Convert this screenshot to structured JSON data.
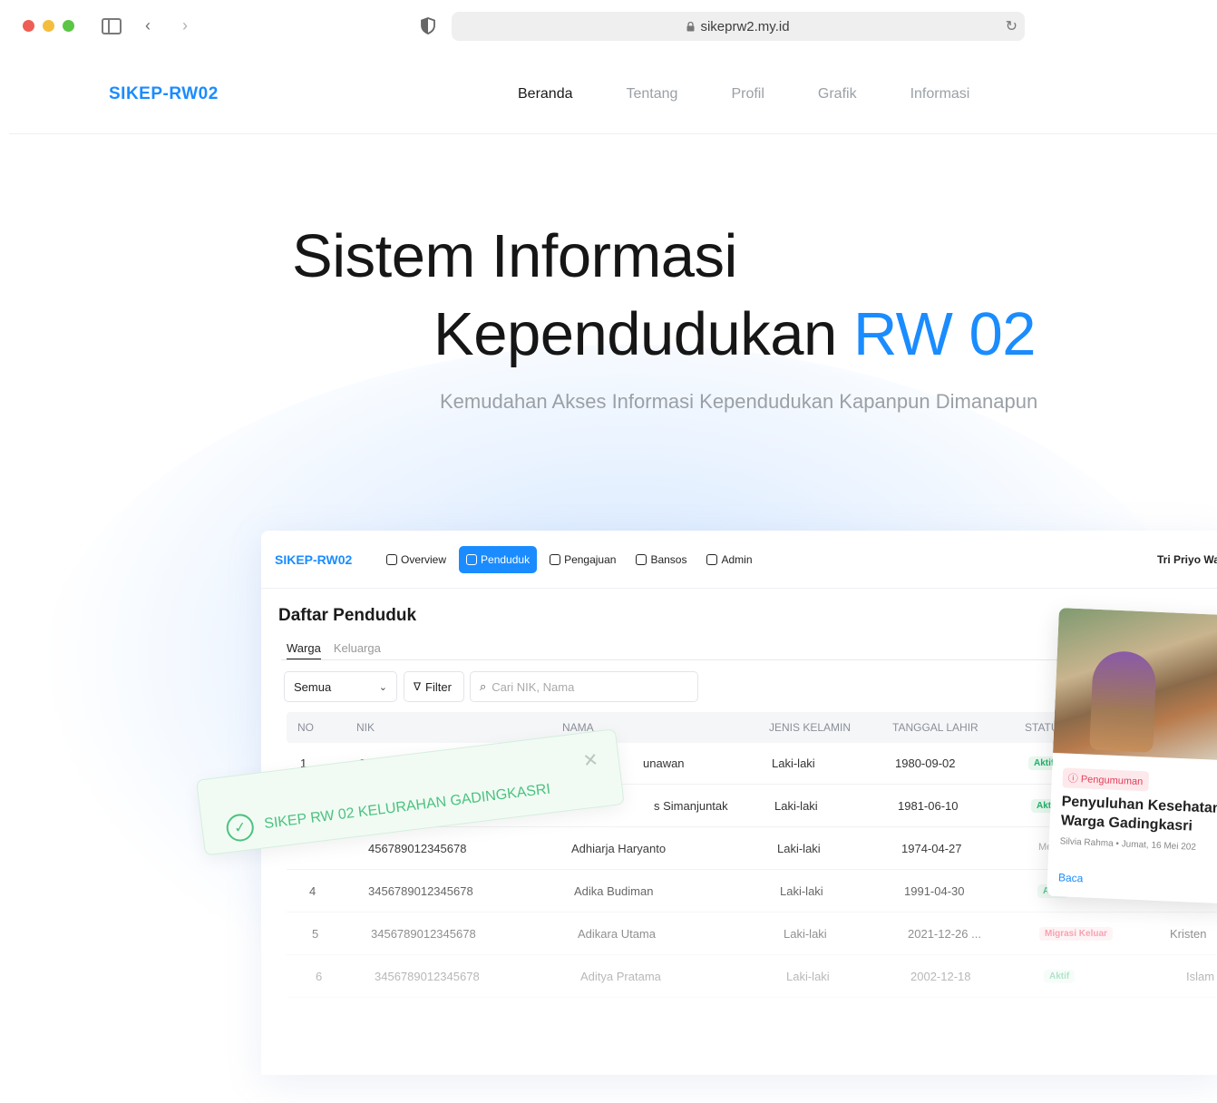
{
  "browser": {
    "url": "sikeprw2.my.id"
  },
  "site": {
    "brand": "SIKEP-RW02",
    "nav": [
      "Beranda",
      "Tentang",
      "Profil",
      "Grafik",
      "Informasi"
    ],
    "active_nav": "Beranda"
  },
  "hero": {
    "title_line1": "Sistem Informasi",
    "title_line2_prefix": "Kependudukan",
    "title_line2_highlight": "RW 02",
    "subtitle": "Kemudahan Akses Informasi Kependudukan Kapanpun Dimanapun"
  },
  "app": {
    "brand": "SIKEP-RW02",
    "tabs": [
      "Overview",
      "Penduduk",
      "Pengajuan",
      "Bansos",
      "Admin"
    ],
    "active_tab": "Penduduk",
    "user": "Tri Priyo Wa",
    "page_title": "Daftar Penduduk",
    "subtabs": [
      "Warga",
      "Keluarga"
    ],
    "select_value": "Semua",
    "filter_label": "Filter",
    "search_placeholder": "Cari NIK, Nama",
    "columns": [
      "NO",
      "NIK",
      "NAMA",
      "JENIS KELAMIN",
      "TANGGAL LAHIR",
      "STATU"
    ],
    "rows": [
      {
        "no": "1",
        "nik": "3456789012345678",
        "nama": "unawan",
        "jk": "Laki-laki",
        "tgl": "1980-09-02",
        "status": "Aktif",
        "agama": ""
      },
      {
        "no": "",
        "nik": "",
        "nama": "s Simanjuntak",
        "jk": "Laki-laki",
        "tgl": "1981-06-10",
        "status": "Aktif",
        "agama": ""
      },
      {
        "no": "",
        "nik": "456789012345678",
        "nama": "Adhiarja Haryanto",
        "jk": "Laki-laki",
        "tgl": "1974-04-27",
        "status": "Mer",
        "agama": ""
      },
      {
        "no": "4",
        "nik": "3456789012345678",
        "nama": "Adika Budiman",
        "jk": "Laki-laki",
        "tgl": "1991-04-30",
        "status": "Aktif",
        "agama": ""
      },
      {
        "no": "5",
        "nik": "3456789012345678",
        "nama": "Adikara Utama",
        "jk": "Laki-laki",
        "tgl": "2021-12-26 ...",
        "status": "Migrasi Keluar",
        "agama": "Kristen"
      },
      {
        "no": "6",
        "nik": "3456789012345678",
        "nama": "Aditya Pratama",
        "jk": "Laki-laki",
        "tgl": "2002-12-18",
        "status": "Aktif",
        "agama": "Islam"
      }
    ]
  },
  "toast": {
    "message": "SIKEP RW 02 KELURAHAN GADINGKASRI"
  },
  "card": {
    "badge": "Pengumuman",
    "title": "Penyuluhan Kesehatan Warga Gadingkasri",
    "author": "Silvia Rahma",
    "date": "Jumat, 16 Mei 202",
    "link": "Baca"
  },
  "colors": {
    "brand_blue": "#1a8cff",
    "success_green": "#4cc27f",
    "danger_red": "#e0405a"
  }
}
